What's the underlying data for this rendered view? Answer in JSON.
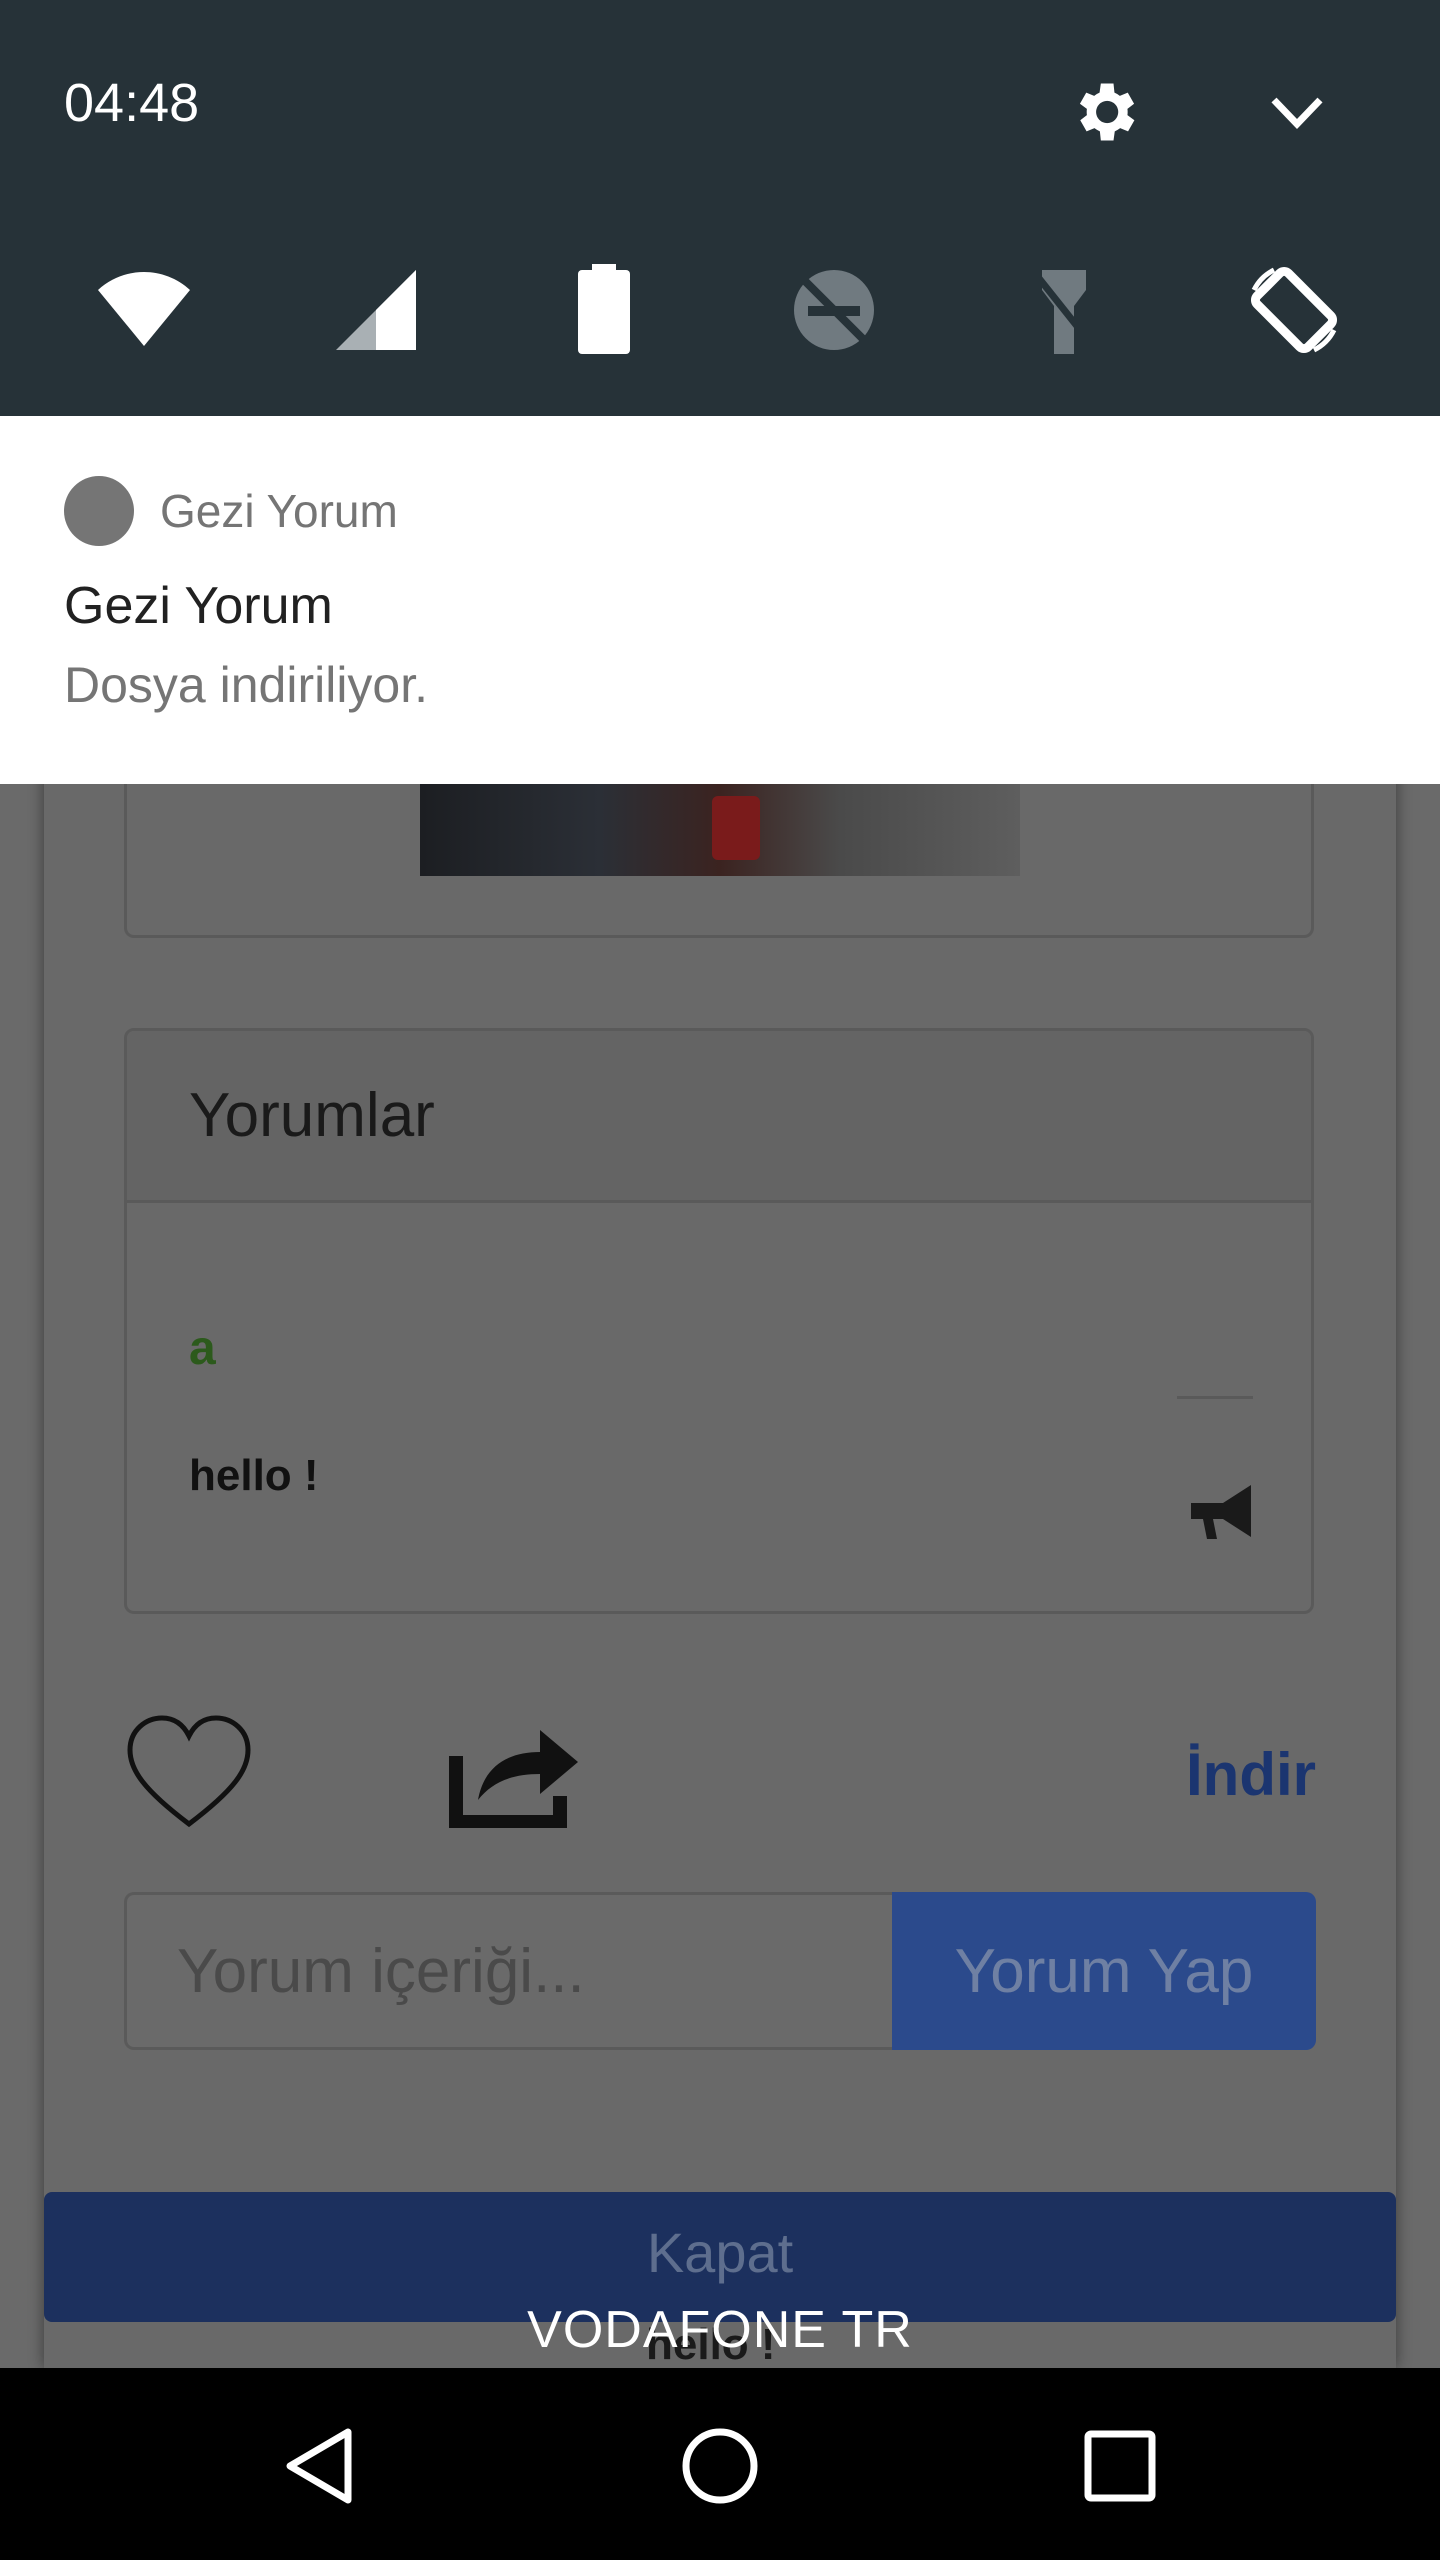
{
  "status_bar": {
    "time": "04:48"
  },
  "notification": {
    "app_name": "Gezi Yorum",
    "title": "Gezi Yorum",
    "text": "Dosya indiriliyor."
  },
  "comments": {
    "title": "Yorumlar",
    "items": [
      {
        "author": "a",
        "text": "hello !"
      }
    ]
  },
  "actions": {
    "download_label": "İndir"
  },
  "comment_form": {
    "placeholder": "Yorum içeriği...",
    "submit_label": "Yorum Yap"
  },
  "dialog": {
    "close_label": "Kapat",
    "bottom_text": "hello !"
  },
  "carrier": "VODAFONE TR",
  "colors": {
    "status_bar_bg": "#263238",
    "button_blue": "#2b4a8c",
    "close_button": "#1c305e",
    "link_blue": "#1b3570"
  },
  "icons": [
    "settings-icon",
    "expand-icon",
    "wifi-icon",
    "signal-icon",
    "battery-icon",
    "dnd-icon",
    "flashlight-icon",
    "auto-rotate-icon",
    "heart-icon",
    "share-icon",
    "megaphone-icon",
    "back-icon",
    "home-icon",
    "recents-icon"
  ]
}
